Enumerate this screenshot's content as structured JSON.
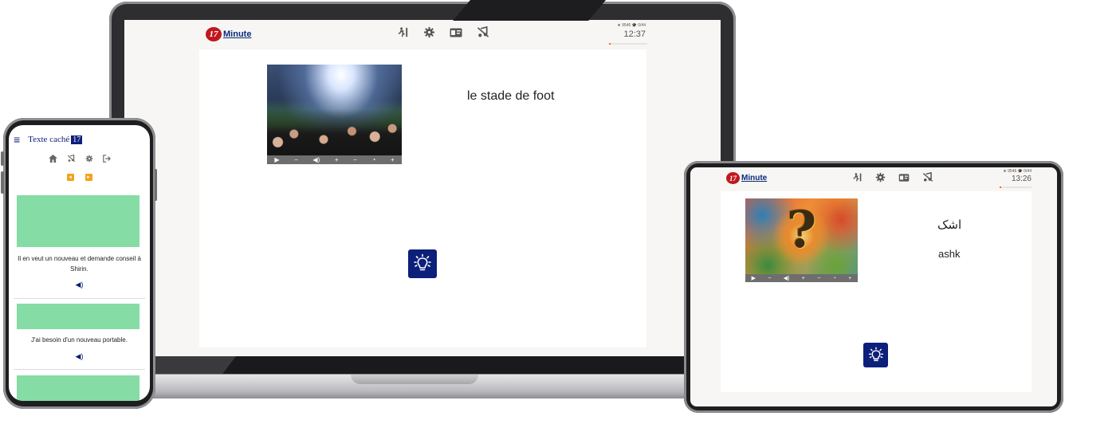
{
  "brand": {
    "badge": "17",
    "name": "Minute",
    "accent": "#0c1f7a",
    "progress_color": "#f26a1b"
  },
  "laptop": {
    "stats": "★ 9546  🎓 0/44",
    "timer": "12:37",
    "timer_progress": 0.05,
    "card": {
      "word": "le stade de foot",
      "image": "stadium-crowd-photo"
    }
  },
  "tablet": {
    "stats": "★ 9546  🎓 0/44",
    "timer": "13:26",
    "timer_progress": 0.05,
    "card": {
      "word": "اشک",
      "transliteration": "ashk",
      "image": "painted-question-mark"
    }
  },
  "controls": {
    "play": "▶",
    "vol_minus": "−",
    "vol": "◀)",
    "vol_plus": "+",
    "speed_minus": "−",
    "speed": "◔",
    "speed_plus": "+"
  },
  "phone": {
    "menu": "≡",
    "title": "Texte caché",
    "badge": "17",
    "items": [
      {
        "sentence": "Il en veut un nouveau et demande conseil à Shirin."
      },
      {
        "sentence": "J'ai besoin d'un nouveau portable."
      }
    ],
    "speaker": "◀)"
  }
}
